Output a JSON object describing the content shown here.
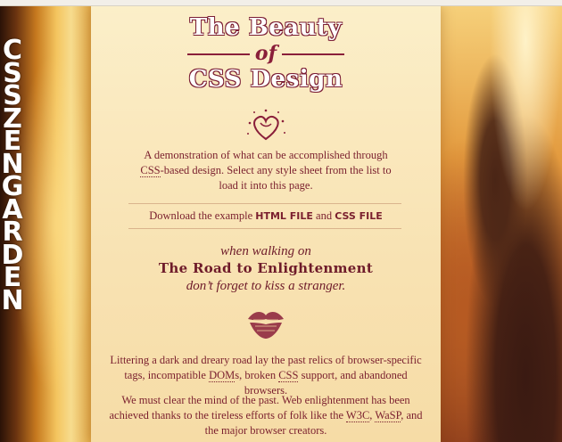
{
  "header": {
    "vertical_title": "CSSZENGARDEN",
    "logo_line1": "The Beauty",
    "logo_line2": "of",
    "logo_line3": "CSS Design"
  },
  "intro": {
    "before_abbr": "A demonstration of what can be accomplished through ",
    "abbr_css": "CSS",
    "after_abbr": "-based design. Select any style sheet from the list to load it into this page."
  },
  "downloads": {
    "prefix": "Download the example ",
    "html_link": "HTML FILE",
    "and": " and ",
    "css_link": "CSS FILE"
  },
  "road": {
    "line1": "when walking on",
    "line2": "The Road to Enlightenment",
    "line3": "don’t forget to kiss a stranger."
  },
  "paragraphs": {
    "p1_a": "Littering a dark and dreary road lay the past relics of browser-specific tags, incompatible ",
    "p1_doms": "DOM",
    "p1_b": "s, broken ",
    "p1_css": "CSS",
    "p1_c": " support, and abandoned browsers.",
    "p2_a": "We must clear the mind of the past. Web enlightenment has been achieved thanks to the tireless efforts of folk like the ",
    "p2_w3c": "W3C",
    "p2_b": ", ",
    "p2_wasp": "WaSP",
    "p2_c": ", and the major browser creators."
  },
  "icons": {
    "heart": "heart-doodle-icon",
    "kiss": "lipstick-kiss-icon"
  },
  "colors": {
    "accent": "#7a1f2e",
    "panel": "#f9e6b8"
  }
}
